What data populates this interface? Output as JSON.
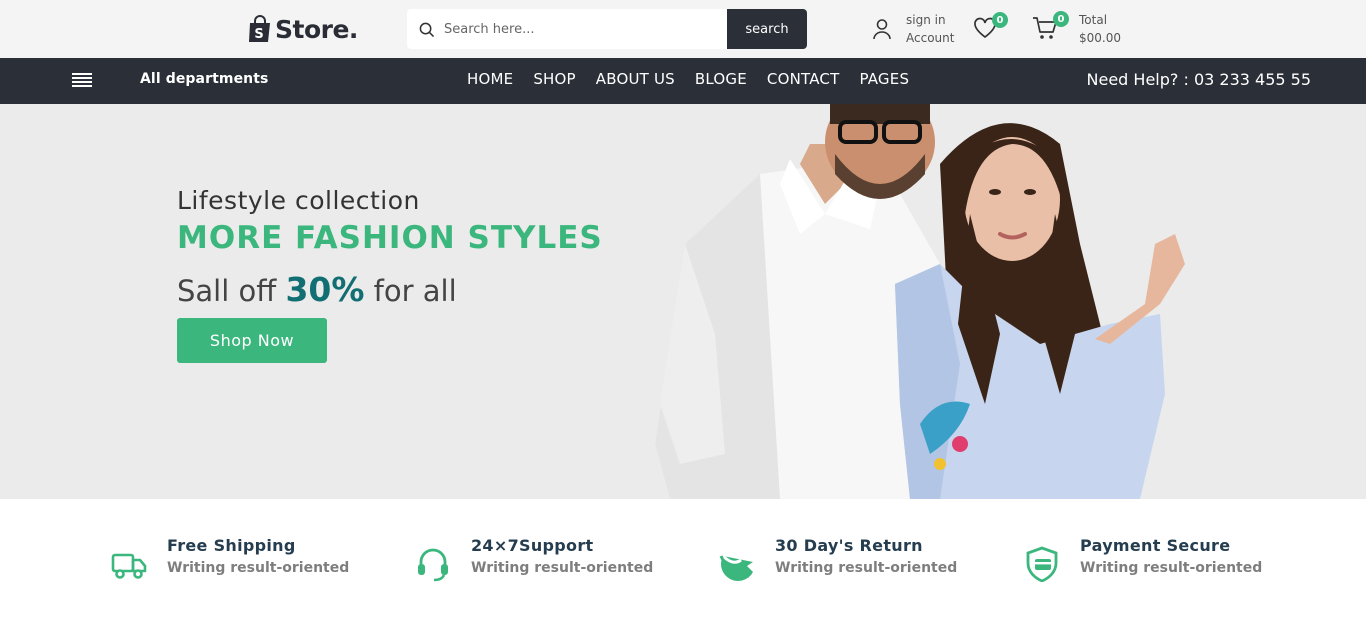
{
  "header": {
    "logo_text": "Store.",
    "search": {
      "placeholder": "Search here...",
      "button_label": "search"
    },
    "account": {
      "line1": "sign in",
      "line2": "Account"
    },
    "wishlist": {
      "count": "0"
    },
    "cart": {
      "count": "0",
      "total_label": "Total",
      "total_value": "$00.00"
    }
  },
  "nav": {
    "departments_label": "All departments",
    "items": [
      {
        "label": "HOME"
      },
      {
        "label": "SHOP"
      },
      {
        "label": "ABOUT US"
      },
      {
        "label": "BLOGE"
      },
      {
        "label": "CONTACT"
      },
      {
        "label": "PAGES"
      }
    ],
    "help_text": "Need Help? : 03 233 455 55"
  },
  "hero": {
    "kicker": "Lifestyle collection",
    "title": "MORE FASHION STYLES",
    "sale_prefix": "Sall off",
    "sale_percent": "30%",
    "sale_suffix": "for all",
    "button_label": "Shop Now"
  },
  "features": [
    {
      "icon": "truck-icon",
      "title": "Free Shipping",
      "subtitle": "Writing result-oriented"
    },
    {
      "icon": "headset-icon",
      "title": "24×7Support",
      "subtitle": "Writing result-oriented"
    },
    {
      "icon": "return-icon",
      "title": "30 Day's Return",
      "subtitle": "Writing result-oriented"
    },
    {
      "icon": "shield-card-icon",
      "title": "Payment Secure",
      "subtitle": "Writing result-oriented"
    }
  ],
  "colors": {
    "accent": "#3bb77e",
    "dark": "#2b2f38",
    "teal": "#116e73",
    "hero_bg": "#ebebeb"
  }
}
